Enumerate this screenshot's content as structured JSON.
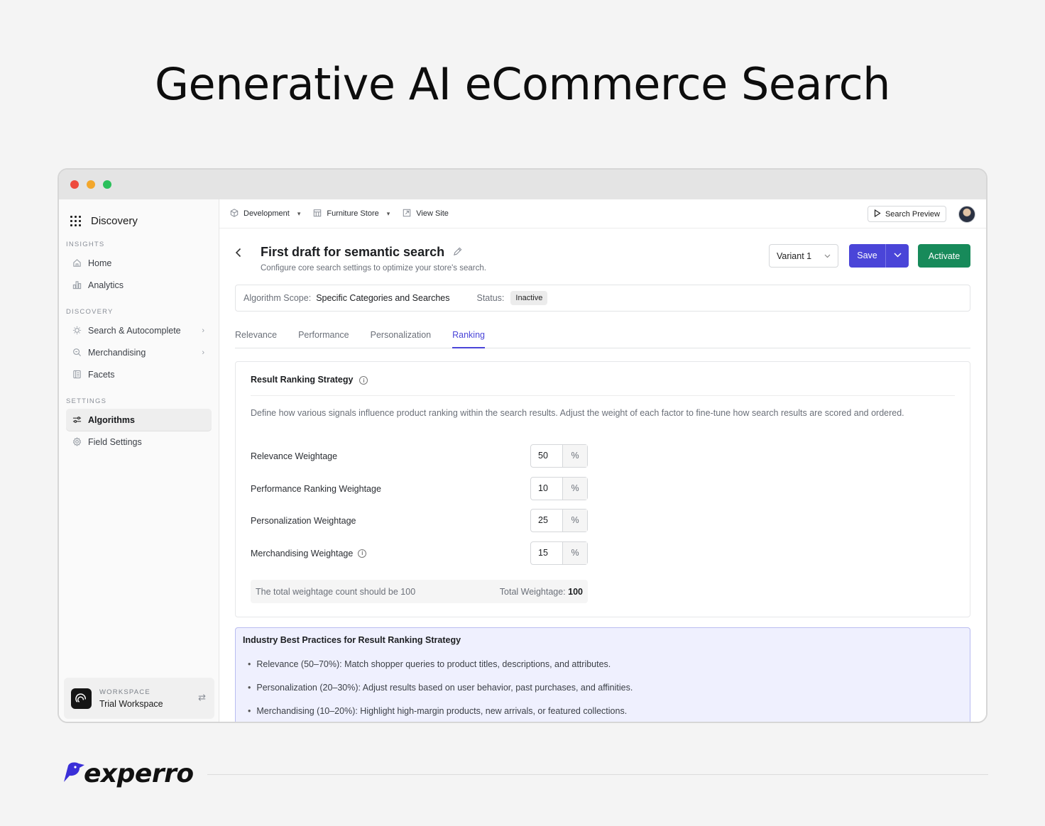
{
  "hero": {
    "title": "Generative AI eCommerce Search"
  },
  "sidebar": {
    "brand": "Discovery",
    "sections": {
      "insights": "INSIGHTS",
      "discovery": "DISCOVERY",
      "settings": "SETTINGS"
    },
    "items": {
      "home": "Home",
      "analytics": "Analytics",
      "search": "Search & Autocomplete",
      "merchandising": "Merchandising",
      "facets": "Facets",
      "algorithms": "Algorithms",
      "field_settings": "Field Settings"
    },
    "workspace": {
      "label": "WORKSPACE",
      "name": "Trial Workspace"
    }
  },
  "topbar": {
    "environment": "Development",
    "store": "Furniture Store",
    "view_site": "View Site",
    "search_preview": "Search Preview"
  },
  "page": {
    "title": "First draft for semantic search",
    "subtitle": "Configure core search settings to optimize your store's search.",
    "variant": "Variant 1",
    "save": "Save",
    "activate": "Activate",
    "scope_label": "Algorithm Scope:",
    "scope_value": "Specific Categories and Searches",
    "status_label": "Status:",
    "status_value": "Inactive"
  },
  "tabs": [
    "Relevance",
    "Performance",
    "Personalization",
    "Ranking"
  ],
  "ranking": {
    "title": "Result Ranking Strategy",
    "description": "Define how various signals influence product ranking within the search results. Adjust the weight of each factor to fine-tune how search results are scored and ordered.",
    "weights": [
      {
        "label": "Relevance Weightage",
        "value": "50",
        "unit": "%"
      },
      {
        "label": "Performance Ranking Weightage",
        "value": "10",
        "unit": "%"
      },
      {
        "label": "Personalization Weightage",
        "value": "25",
        "unit": "%"
      },
      {
        "label": "Merchandising Weightage",
        "value": "15",
        "unit": "%"
      }
    ],
    "total_note": "The total weightage count should be 100",
    "total_label": "Total Weightage:",
    "total_value": "100"
  },
  "best_practices": {
    "title": "Industry Best Practices for Result Ranking Strategy",
    "items": [
      "Relevance (50–70%): Match shopper queries to product titles, descriptions, and attributes.",
      "Personalization (20–30%): Adjust results based on user behavior, past purchases, and affinities.",
      "Merchandising (10–20%): Highlight high-margin products, new arrivals, or featured collections."
    ]
  },
  "footer": {
    "logo": "experro"
  },
  "colors": {
    "accent": "#4a45d8",
    "activate": "#178a5a"
  }
}
